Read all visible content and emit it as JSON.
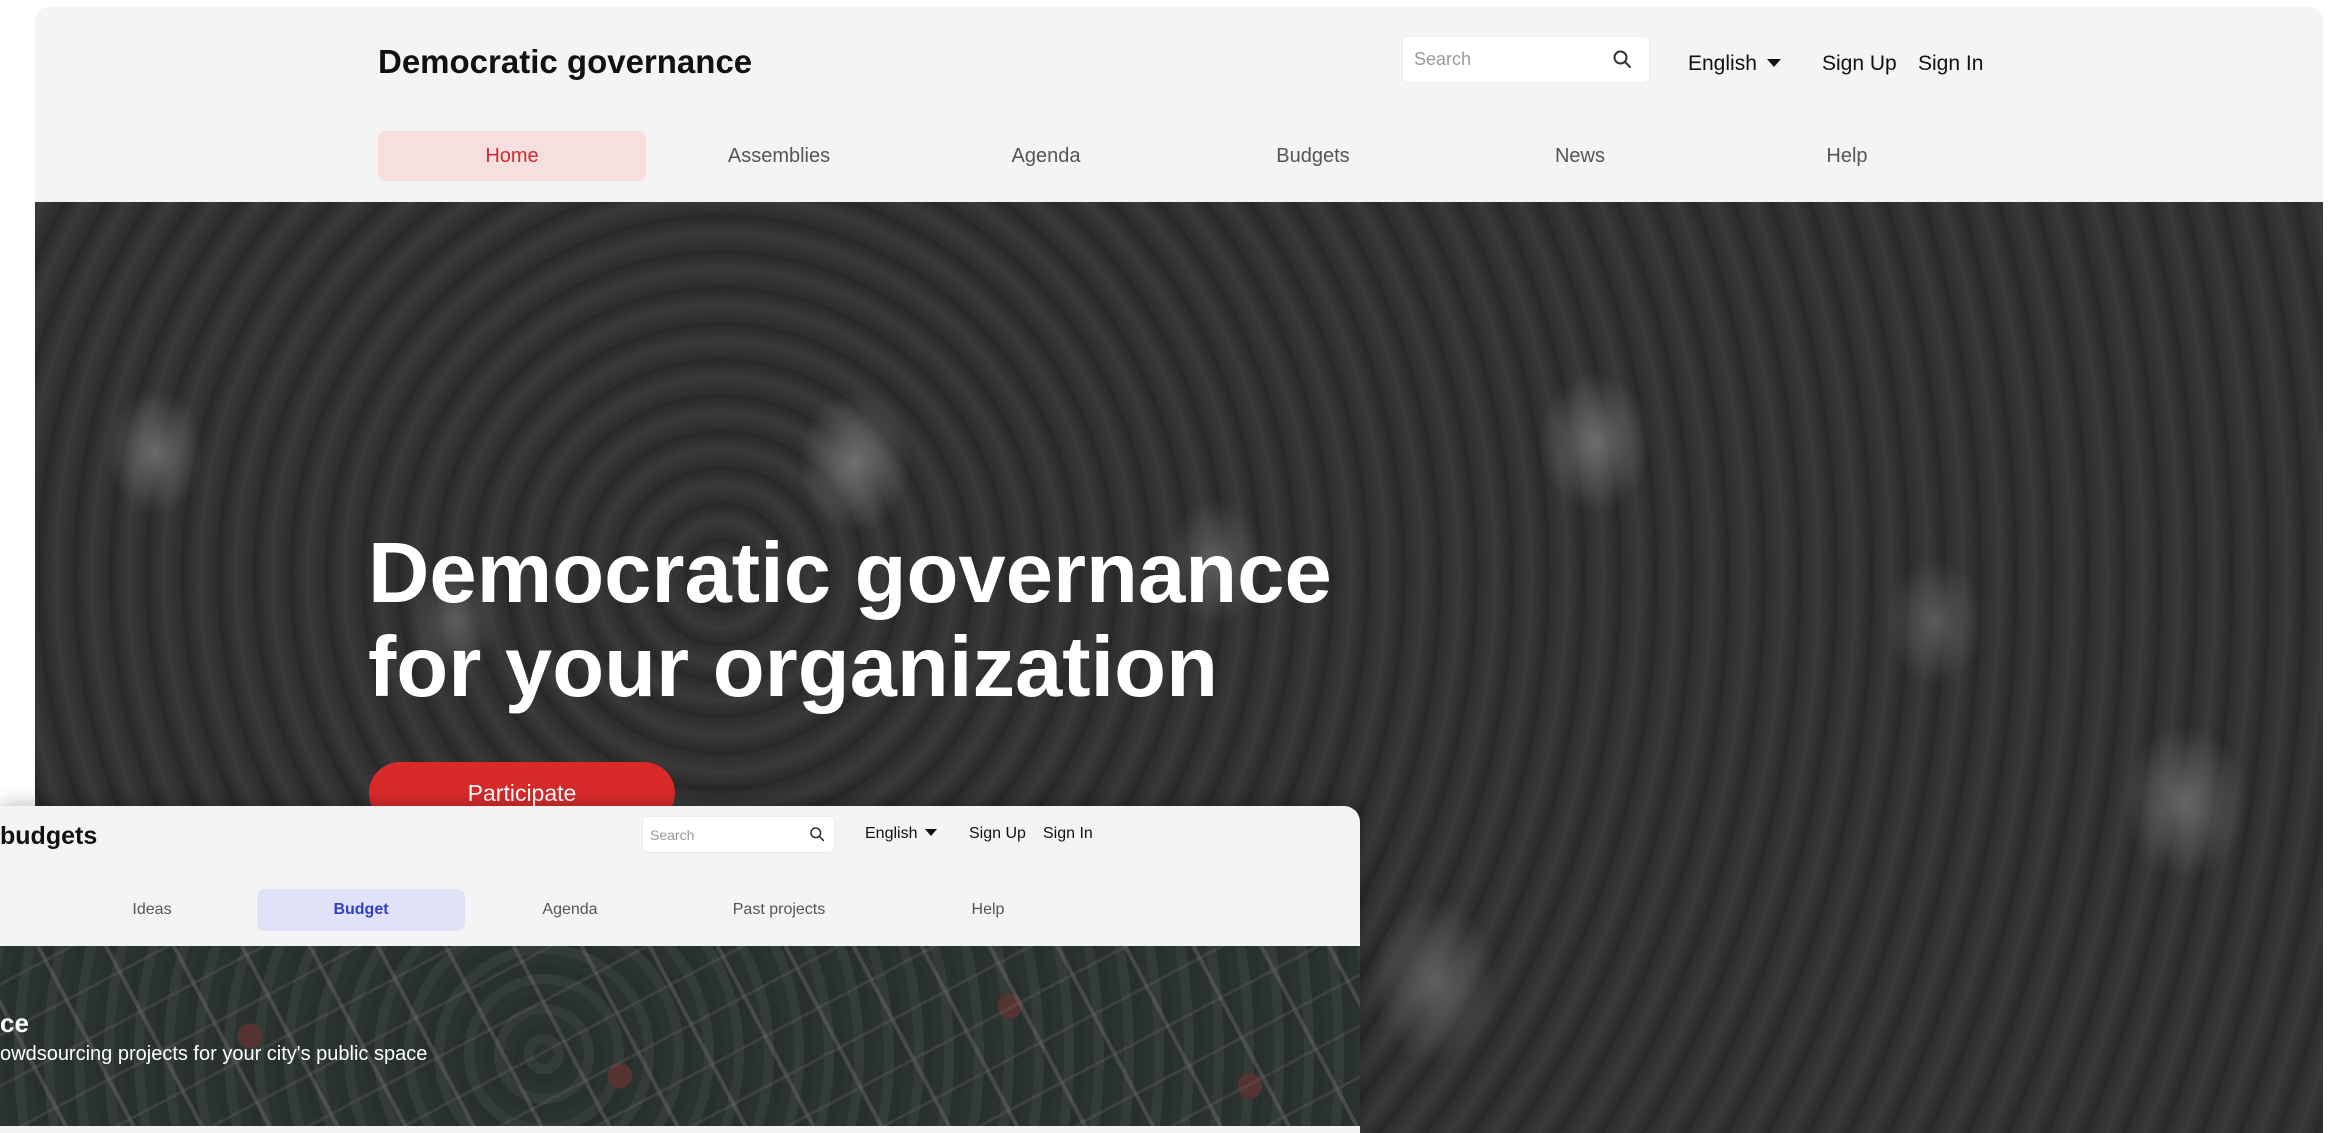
{
  "back_window": {
    "brand": "Democratic governance",
    "search": {
      "placeholder": "Search"
    },
    "language": "English",
    "sign_up": "Sign Up",
    "sign_in": "Sign In",
    "nav": [
      "Home",
      "Assemblies",
      "Agenda",
      "Budgets",
      "News",
      "Help"
    ],
    "active_nav": "Home",
    "hero": {
      "heading_line1": "Democratic governance",
      "heading_line2": "for your organization",
      "cta": "Participate"
    }
  },
  "front_window": {
    "brand": "budgets",
    "search": {
      "placeholder": "Search"
    },
    "language": "English",
    "sign_up": "Sign Up",
    "sign_in": "Sign In",
    "nav": [
      "Ideas",
      "Budget",
      "Agenda",
      "Past projects",
      "Help"
    ],
    "active_nav": "Budget",
    "hero": {
      "title": "ce",
      "subtitle": "owdsourcing projects for your city's public space"
    }
  },
  "colors": {
    "accent_red": "#d92a2a",
    "active_red_bg": "#f6dfdf",
    "accent_blue": "#2f3ec6",
    "active_blue_bg": "#e1e2f8",
    "header_bg": "#f4f4f4"
  },
  "icons": {
    "search": "search-icon",
    "dropdown": "caret-down-icon"
  }
}
